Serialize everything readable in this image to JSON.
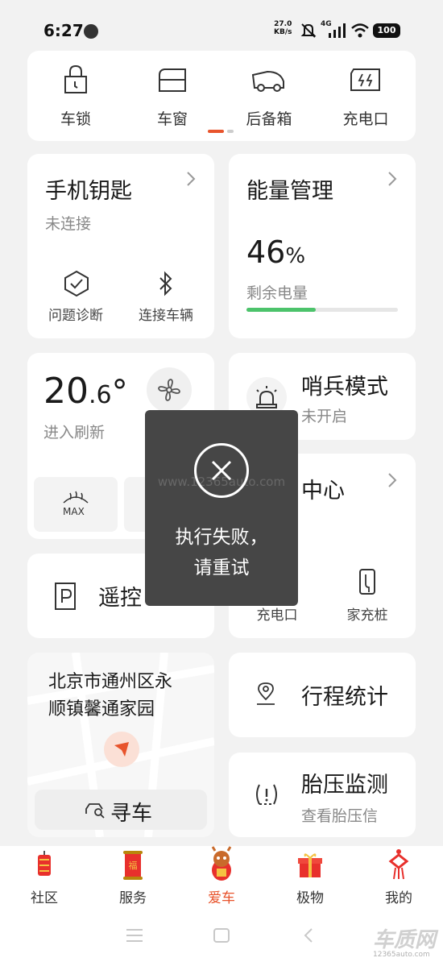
{
  "status_bar": {
    "time": "6:27",
    "net_speed_value": "27.0",
    "net_speed_unit": "KB/s",
    "network": "4G",
    "battery": "100"
  },
  "quick_actions": [
    {
      "label": "车锁",
      "icon": "lock-icon"
    },
    {
      "label": "车窗",
      "icon": "car-window-icon"
    },
    {
      "label": "后备箱",
      "icon": "trunk-icon"
    },
    {
      "label": "充电口",
      "icon": "charge-port-icon"
    }
  ],
  "phone_key": {
    "title": "手机钥匙",
    "status": "未连接",
    "diagnose_label": "问题诊断",
    "connect_label": "连接车辆"
  },
  "energy": {
    "title": "能量管理",
    "percent_value": "46",
    "percent_unit": "%",
    "label": "剩余电量",
    "level": 0.46,
    "bar_color": "#4cc36b"
  },
  "climate": {
    "temp_int": "20",
    "temp_dec": ".6",
    "temp_unit": "°",
    "status": "进入刷新",
    "defrost_label": "MAX"
  },
  "sentry": {
    "title": "哨兵模式",
    "status": "未开启"
  },
  "charging": {
    "title": "中心",
    "port_label": "充电口",
    "home_label": "家充桩"
  },
  "remote": {
    "title": "遥控"
  },
  "location": {
    "address_line1": "北京市通州区永",
    "address_line2": "顺镇馨通家园",
    "find_car_label": "寻车"
  },
  "trip": {
    "title": "行程统计"
  },
  "tire": {
    "title": "胎压监测",
    "sub": "查看胎压信"
  },
  "toast": {
    "line1": "执行失败，",
    "line2": "请重试",
    "watermark": "www.12365auto.com"
  },
  "tabs": [
    {
      "label": "社区",
      "active": false
    },
    {
      "label": "服务",
      "active": false
    },
    {
      "label": "爱车",
      "active": true
    },
    {
      "label": "极物",
      "active": false
    },
    {
      "label": "我的",
      "active": false
    }
  ],
  "branding": {
    "logo_text": "车质网",
    "logo_url_text": "12365auto.com"
  },
  "colors": {
    "accent": "#e8542c",
    "active_tab": "#e8542c"
  }
}
